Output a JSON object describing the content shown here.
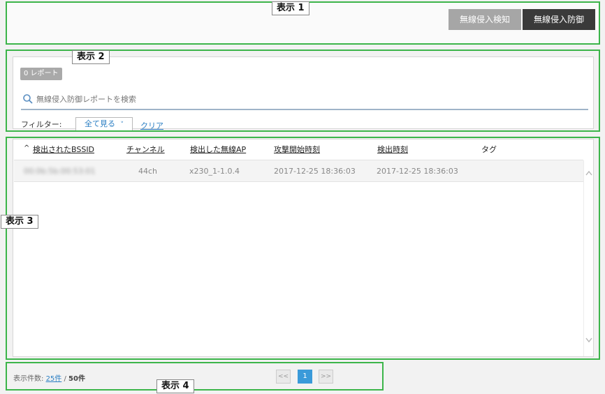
{
  "annotations": {
    "label1": "表示 1",
    "label2": "表示 2",
    "label3": "表示 3",
    "label4": "表示 4"
  },
  "header": {
    "detect_button": "無線侵入検知",
    "protect_button": "無線侵入防御"
  },
  "reports": {
    "count_badge": "0 レポート",
    "search_placeholder": "無線侵入防御レポートを検索",
    "filter_label": "フィルター:",
    "filter_value": "全て見る",
    "filter_chevron": "˅",
    "clear_link": "クリア"
  },
  "table": {
    "sort_indicator": "^",
    "columns": [
      "検出されたBSSID",
      "チャンネル",
      "検出した無線AP",
      "攻撃開始時刻",
      "検出時刻",
      "タグ"
    ],
    "rows": [
      {
        "bssid": "00:0b:5b:00:53:01",
        "channel": "44ch",
        "ap": "x230_1-1.0.4",
        "attack_start": "2017-12-25 18:36:03",
        "detected_at": "2017-12-25 18:36:03",
        "tag": ""
      }
    ]
  },
  "footer": {
    "display_count_label": "表示件数:",
    "page_size_link": "25件",
    "separator": "/",
    "total": "50件"
  },
  "pagination": {
    "prev_label": "<<",
    "current_page": "1",
    "next_label": ">>"
  },
  "icons": {
    "search": "search-icon",
    "scroll_up": "chevron-up-icon",
    "scroll_down": "chevron-down-icon"
  },
  "colors": {
    "annotation_green": "#3cb54a",
    "link_blue": "#2b7fc3",
    "button_dark": "#3a3a3a",
    "button_gray": "#a6a6a6",
    "active_page": "#3a9ad9"
  }
}
